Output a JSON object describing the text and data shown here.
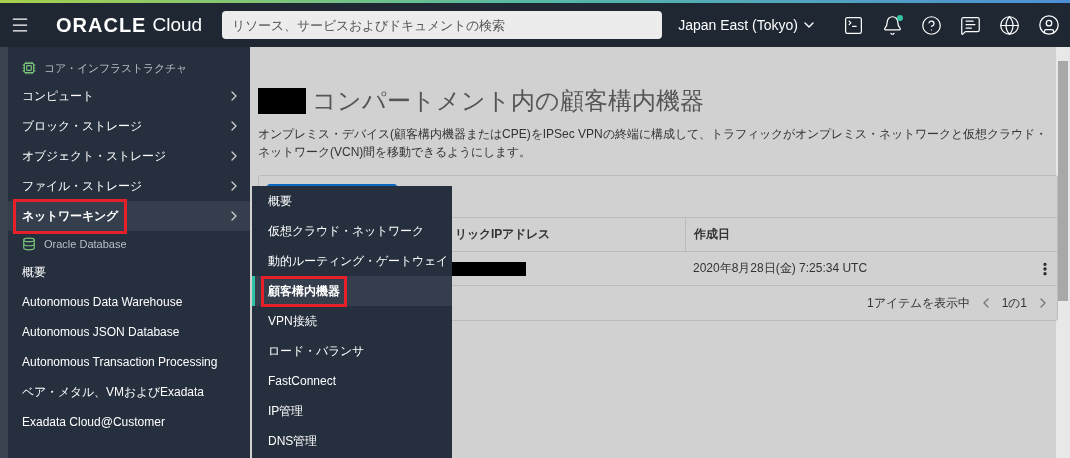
{
  "topbar": {
    "logo": "ORACLE",
    "product": "Cloud",
    "search": {
      "placeholder": "リソース、サービスおよびドキュメントの検索"
    },
    "region": "Japan East (Tokyo)",
    "notifications_unread": true
  },
  "sidebar": {
    "items": [
      {
        "kind": "core",
        "label": "コア・インフラストラクチャ"
      },
      {
        "kind": "item",
        "label": "コンピュート",
        "submenu": true,
        "selected": false,
        "annotated": false
      },
      {
        "kind": "item",
        "label": "ブロック・ストレージ",
        "submenu": true,
        "selected": false,
        "annotated": false
      },
      {
        "kind": "item",
        "label": "オブジェクト・ストレージ",
        "submenu": true,
        "selected": false,
        "annotated": false
      },
      {
        "kind": "item",
        "label": "ファイル・ストレージ",
        "submenu": true,
        "selected": false,
        "annotated": false
      },
      {
        "kind": "item",
        "label": "ネットワーキング",
        "submenu": true,
        "selected": true,
        "annotated": true
      },
      {
        "kind": "database",
        "label": "Oracle Database"
      },
      {
        "kind": "item",
        "label": "概要",
        "submenu": false,
        "selected": false,
        "annotated": false
      },
      {
        "kind": "item",
        "label": "Autonomous Data Warehouse",
        "submenu": false,
        "selected": false,
        "annotated": false
      },
      {
        "kind": "item",
        "label": "Autonomous JSON Database",
        "submenu": false,
        "selected": false,
        "annotated": false
      },
      {
        "kind": "item",
        "label": "Autonomous Transaction Processing",
        "submenu": false,
        "selected": false,
        "annotated": false
      },
      {
        "kind": "item",
        "label": "ベア・メタル、VMおよびExadata",
        "submenu": false,
        "selected": false,
        "annotated": false
      },
      {
        "kind": "item",
        "label": "Exadata Cloud@Customer",
        "submenu": false,
        "selected": false,
        "annotated": false
      }
    ]
  },
  "submenu": {
    "items": [
      {
        "label": "概要",
        "selected": false,
        "annotated": false
      },
      {
        "label": "仮想クラウド・ネットワーク",
        "selected": false,
        "annotated": false
      },
      {
        "label": "動的ルーティング・ゲートウェイ",
        "selected": false,
        "annotated": false
      },
      {
        "label": "顧客構内機器",
        "selected": true,
        "annotated": true
      },
      {
        "label": "VPN接続",
        "selected": false,
        "annotated": false
      },
      {
        "label": "ロード・バランサ",
        "selected": false,
        "annotated": false
      },
      {
        "label": "FastConnect",
        "selected": false,
        "annotated": false
      },
      {
        "label": "IP管理",
        "selected": false,
        "annotated": false
      },
      {
        "label": "DNS管理",
        "selected": false,
        "annotated": false
      }
    ]
  },
  "page": {
    "title": "コンパートメント内の顧客構内機器",
    "description": "オンプレミス・デバイス(顧客構内機器またはCPE)をIPSec VPNの終端に構成して、トラフィックがオンプレミス・ネットワークと仮想クラウド・ネットワーク(VCN)間を移動できるようにします。",
    "table": {
      "columns": [
        "リックIPアドレス",
        "作成日"
      ],
      "rows": [
        {
          "created": "2020年8月28日(金) 7:25:34 UTC"
        }
      ],
      "footer": {
        "count": "1アイテムを表示中",
        "pages": "1の1"
      }
    }
  }
}
